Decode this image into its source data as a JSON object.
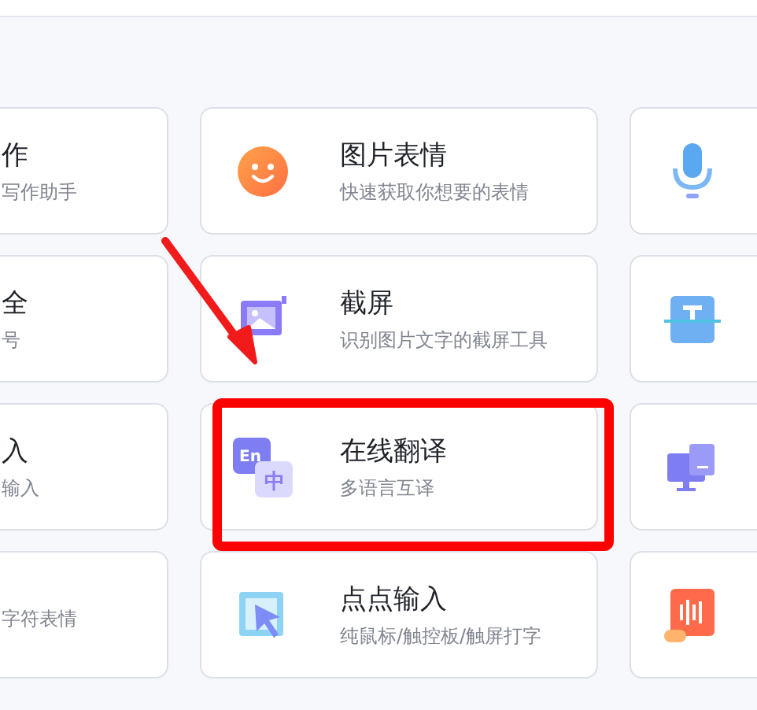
{
  "cards": [
    {
      "kind": "cut_left",
      "title": "作",
      "subtitle": "写作助手"
    },
    {
      "kind": "full",
      "title": "图片表情",
      "subtitle": "快速获取你想要的表情"
    },
    {
      "kind": "icon_only"
    },
    {
      "kind": "cut_left",
      "title": "全",
      "subtitle": "号"
    },
    {
      "kind": "full",
      "title": "截屏",
      "subtitle": "识别图片文字的截屏工具"
    },
    {
      "kind": "icon_only"
    },
    {
      "kind": "cut_left",
      "title": "入",
      "subtitle": "输入"
    },
    {
      "kind": "full",
      "title": "在线翻译",
      "subtitle": "多语言互译",
      "icon_texts": [
        "En",
        "中"
      ]
    },
    {
      "kind": "icon_only"
    },
    {
      "kind": "cut_left",
      "subtitle": "字符表情"
    },
    {
      "kind": "full",
      "title": "点点输入",
      "subtitle": "纯鼠标/触控板/触屏打字"
    },
    {
      "kind": "icon_only"
    }
  ]
}
